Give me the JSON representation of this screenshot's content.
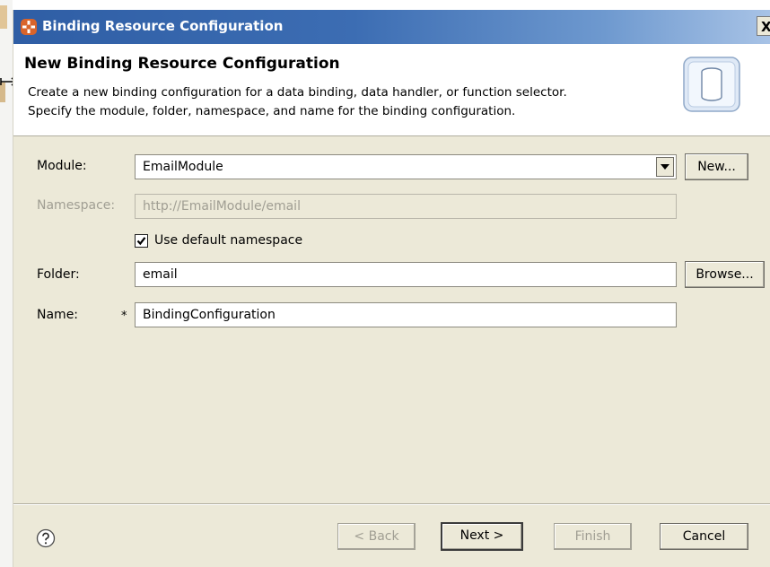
{
  "window": {
    "title": "Binding Resource Configuration",
    "close_glyph": "X"
  },
  "banner": {
    "title": "New Binding Resource Configuration",
    "description_line1": "Create a new binding configuration for a data binding, data handler, or function selector.",
    "description_line2": "Specify the module, folder, namespace, and name for the binding configuration.",
    "image_icon": "cylinder-icon"
  },
  "form": {
    "module": {
      "label": "Module:",
      "value": "EmailModule",
      "new_button": "New..."
    },
    "namespace": {
      "label": "Namespace:",
      "value": "http://EmailModule/email",
      "enabled": false
    },
    "use_default_namespace": {
      "label": "Use default namespace",
      "checked": true
    },
    "folder": {
      "label": "Folder:",
      "value": "email",
      "browse_button": "Browse..."
    },
    "name": {
      "label": "Name:",
      "required_marker": "*",
      "value": "BindingConfiguration"
    }
  },
  "footer": {
    "help_icon": "question-circle-icon",
    "back": "< Back",
    "next": "Next >",
    "finish": "Finish",
    "cancel": "Cancel"
  },
  "colors": {
    "titlebar_start": "#2f5ea5",
    "titlebar_end": "#a8c3e6",
    "dialog_bg": "#ece9d8",
    "disabled_text": "#a09e93"
  }
}
